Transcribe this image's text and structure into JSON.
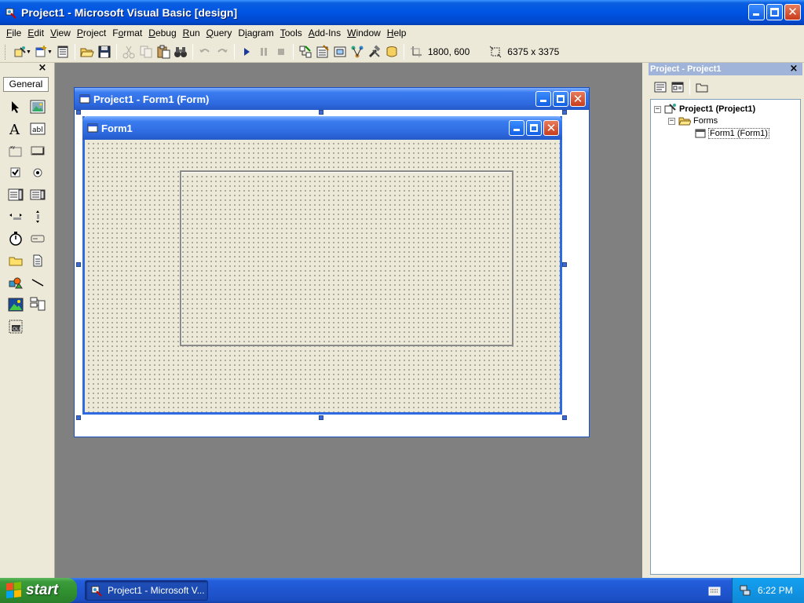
{
  "window": {
    "title": "Project1 - Microsoft Visual Basic [design]"
  },
  "menu": [
    {
      "pre": "",
      "key": "F",
      "post": "ile"
    },
    {
      "pre": "",
      "key": "E",
      "post": "dit"
    },
    {
      "pre": "",
      "key": "V",
      "post": "iew"
    },
    {
      "pre": "",
      "key": "P",
      "post": "roject"
    },
    {
      "pre": "F",
      "key": "o",
      "post": "rmat"
    },
    {
      "pre": "",
      "key": "D",
      "post": "ebug"
    },
    {
      "pre": "",
      "key": "R",
      "post": "un"
    },
    {
      "pre": "",
      "key": "Q",
      "post": "uery"
    },
    {
      "pre": "D",
      "key": "i",
      "post": "agram"
    },
    {
      "pre": "",
      "key": "T",
      "post": "ools"
    },
    {
      "pre": "",
      "key": "A",
      "post": "dd-Ins"
    },
    {
      "pre": "",
      "key": "W",
      "post": "indow"
    },
    {
      "pre": "",
      "key": "H",
      "post": "elp"
    }
  ],
  "toolbar": {
    "position": "1800, 600",
    "size": "6375 x 3375"
  },
  "toolbox": {
    "tab_label": "General",
    "close": "×"
  },
  "designer": {
    "title": "Project1 - Form1 (Form)"
  },
  "form": {
    "title": "Form1"
  },
  "project_explorer": {
    "title": "Project - Project1",
    "close": "×",
    "tree": {
      "project": "Project1 (Project1)",
      "folder": "Forms",
      "form": "Form1 (Form1)"
    }
  },
  "taskbar": {
    "start": "start",
    "task": "Project1 - Microsoft V...",
    "clock": "6:22 PM"
  },
  "colors": {
    "titlebar": "#0054e3",
    "mdi_background": "#808080",
    "start_button": "#3c9c3c",
    "tray": "#0f8ad8"
  }
}
